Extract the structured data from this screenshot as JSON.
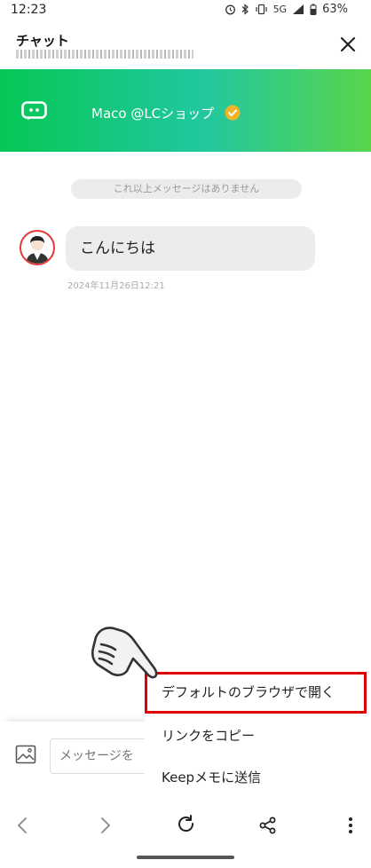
{
  "status_bar": {
    "time": "12:23",
    "network": "5G",
    "battery": "63%"
  },
  "header": {
    "title": "チャット"
  },
  "banner": {
    "name": "Maco @LCショップ"
  },
  "chat": {
    "notice": "これ以上メッセージはありません",
    "messages": [
      {
        "text": "こんにちは",
        "time": "2024年11月26日12:21"
      }
    ]
  },
  "input": {
    "placeholder": "メッセージを"
  },
  "menu": {
    "items": [
      {
        "label": "デフォルトのブラウザで開く",
        "highlighted": true
      },
      {
        "label": "リンクをコピー"
      },
      {
        "label": "Keepメモに送信"
      }
    ]
  },
  "colors": {
    "brand_green": "#06c755",
    "highlight_red": "#e00000",
    "verified_gold": "#f0b429"
  },
  "icons": [
    "alarm-icon",
    "bluetooth-icon",
    "vibrate-icon",
    "signal-icon",
    "battery-icon",
    "close-icon",
    "chat-bot-icon",
    "verified-badge-icon",
    "image-icon",
    "back-icon",
    "forward-icon",
    "reload-icon",
    "share-icon",
    "more-icon",
    "pointing-hand-icon"
  ]
}
